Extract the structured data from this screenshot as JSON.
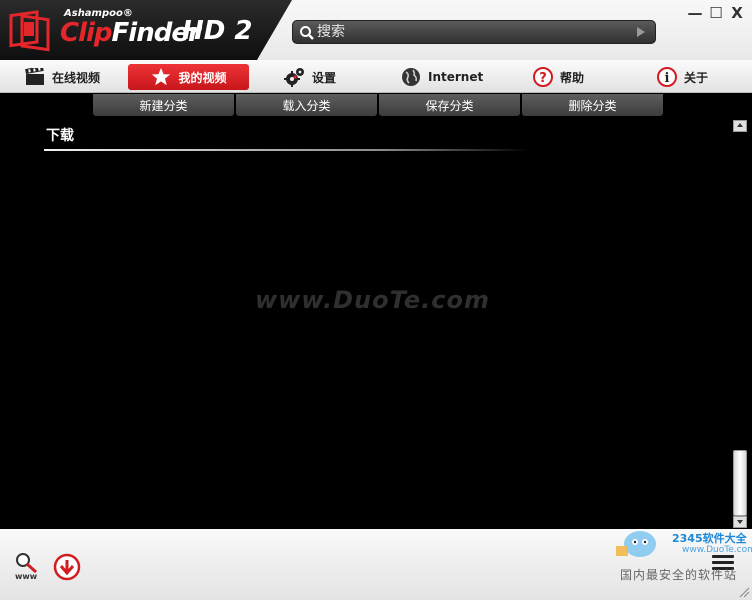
{
  "app": {
    "brand_small": "Ashampoo®",
    "brand_clip": "Clip",
    "brand_finder": "Finder",
    "brand_hd": "HD 2",
    "colors": {
      "accent_red": "#e5262b",
      "background": "#000000"
    }
  },
  "search": {
    "placeholder": "搜索"
  },
  "window": {
    "minimize": "—",
    "maximize": "☐",
    "close": "X"
  },
  "nav": {
    "items": [
      {
        "label": "在线视频",
        "icon": "clapperboard-icon"
      },
      {
        "label": "我的视频",
        "icon": "star-icon",
        "active": true
      },
      {
        "label": "设置",
        "icon": "gears-icon"
      },
      {
        "label": "Internet",
        "icon": "globe-icon"
      },
      {
        "label": "帮助",
        "icon": "question-icon"
      },
      {
        "label": "关于",
        "icon": "info-icon"
      }
    ]
  },
  "categories": {
    "new": "新建分类",
    "load": "载入分类",
    "save": "保存分类",
    "delete": "删除分类"
  },
  "content": {
    "section_title": "下载",
    "watermark": "www.DuoTe.com"
  },
  "footer": {
    "www_label": "www",
    "site_name": "2345软件大全",
    "site_url": "www.DuoTe.com",
    "site_slogan": "国内最安全的软件站"
  }
}
